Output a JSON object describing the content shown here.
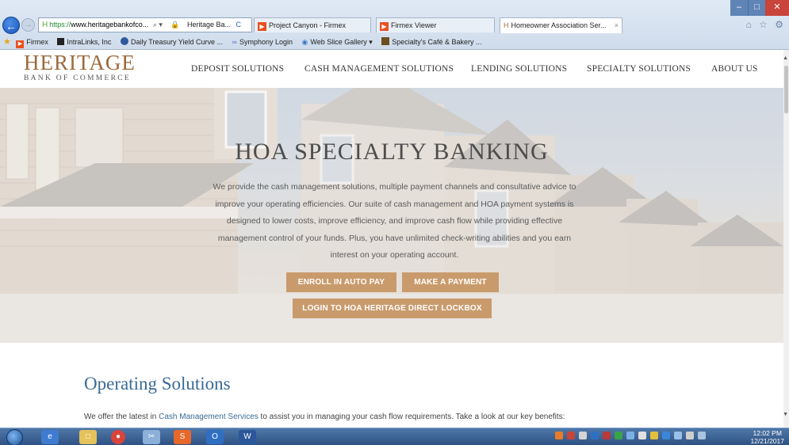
{
  "browser": {
    "address": {
      "https": "https://",
      "host": "www.heritagebankofco...",
      "controls": "⌕ ▾"
    },
    "tabs": [
      {
        "label": "Heritage Ba...",
        "close": "C"
      },
      {
        "label": "Project Canyon - Firmex"
      },
      {
        "label": "Firmex Viewer"
      },
      {
        "label": "Homeowner Association Ser...",
        "close": "×"
      }
    ],
    "favorites": [
      "Firmex",
      "IntraLinks, Inc",
      "Daily Treasury Yield Curve ...",
      "Symphony Login",
      "Web Slice Gallery ▾",
      "Specialty's Café & Bakery ..."
    ],
    "window_controls": {
      "min": "–",
      "max": "□",
      "close": "✕"
    },
    "toolbar_icons": "⌂ ☆ ⚙"
  },
  "site": {
    "logo_main": "HERITAGE",
    "logo_sub": "BANK OF COMMERCE",
    "nav": [
      "DEPOSIT SOLUTIONS",
      "CASH MANAGEMENT SOLUTIONS",
      "LENDING SOLUTIONS",
      "SPECIALTY SOLUTIONS",
      "ABOUT US"
    ]
  },
  "hero": {
    "title": "HOA SPECIALTY BANKING",
    "lines": [
      "We provide the cash management solutions, multiple payment channels and consultative advice to",
      "improve your operating efficiencies. Our suite of cash management and HOA payment systems is",
      "designed to lower costs, improve efficiency, and improve cash flow while providing effective",
      "management control of your funds. Plus, you have unlimited check-writing abilities and you earn",
      "interest on your operating account."
    ],
    "buttons": {
      "enroll": "ENROLL IN AUTO PAY",
      "pay": "MAKE A PAYMENT",
      "lockbox": "LOGIN TO HOA HERITAGE DIRECT LOCKBOX"
    }
  },
  "content": {
    "title": "Operating Solutions",
    "text_before": "We offer the latest in ",
    "link": "Cash Management Services",
    "text_after": " to assist you in managing your cash flow requirements. Take a look at our key benefits:"
  },
  "taskbar": {
    "time": "12:02 PM",
    "date": "12/21/2017",
    "apps": [
      "internet-explorer",
      "file-explorer",
      "chrome",
      "snipping-tool",
      "sublime",
      "outlook",
      "word"
    ]
  },
  "colors": {
    "accent_brown": "#9b6a3c",
    "button": "#c99b6c",
    "link_blue": "#3a6a96"
  }
}
